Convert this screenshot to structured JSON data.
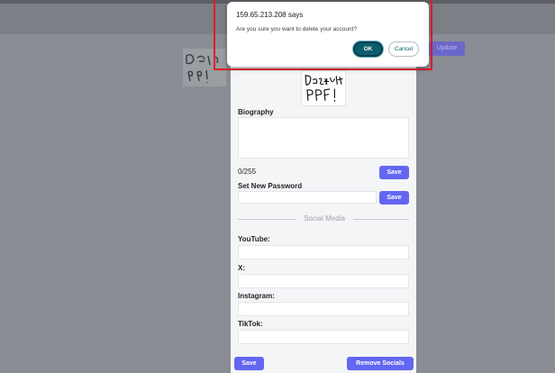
{
  "background": {
    "hidden_button_label": "Update"
  },
  "profile": {
    "pfp_caption": "Default PFP!"
  },
  "form": {
    "biography_label": "Biography",
    "biography_value": "",
    "char_counter": "0/255",
    "save_label": "Save",
    "new_password_label": "Set New Password",
    "new_password_value": "",
    "social_divider": "Social Media",
    "youtube_label": "YouTube:",
    "x_label": "X:",
    "instagram_label": "Instagram:",
    "tiktok_label": "TikTok:",
    "remove_socials_label": "Remove Socials"
  },
  "dialog": {
    "origin": "159.65.213.208 says",
    "message": "Are you sure you want to delete your account?",
    "ok_label": "OK",
    "cancel_label": "Cancel"
  },
  "colors": {
    "accent": "#6366f1",
    "overlay": "#8a8d93",
    "dialog_ok": "#0b5c6b",
    "highlight": "#e11d28"
  }
}
